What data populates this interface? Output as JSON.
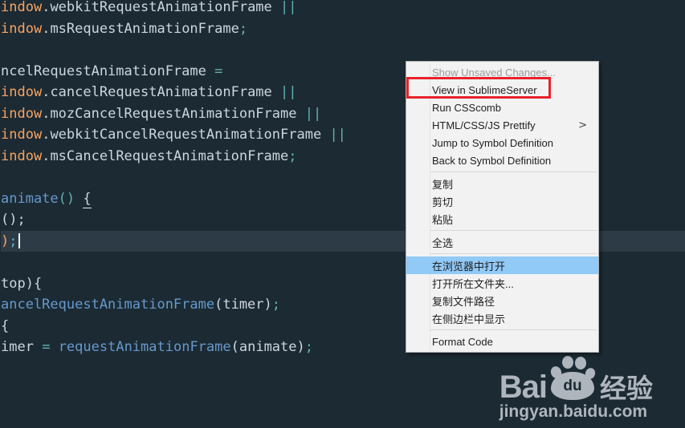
{
  "editor": {
    "background": "#1c2a33",
    "line_highlight": "#2d3b46",
    "caret_color": "#f2f6f8",
    "palette": {
      "fg": "#ccd6de",
      "orange": "#f9a35f",
      "teal": "#5fb3b3",
      "blue": "#6699cc"
    },
    "lines": [
      {
        "tokens": [
          {
            "t": "indow",
            "c": "orange"
          },
          {
            "t": ".",
            "c": "fg"
          },
          {
            "t": "webkitRequestAnimationFrame ",
            "c": "fg"
          },
          {
            "t": "||",
            "c": "teal"
          }
        ]
      },
      {
        "tokens": [
          {
            "t": "indow",
            "c": "orange"
          },
          {
            "t": ".",
            "c": "fg"
          },
          {
            "t": "msRequestAnimationFrame",
            "c": "fg"
          },
          {
            "t": ";",
            "c": "teal"
          }
        ]
      },
      {
        "tokens": []
      },
      {
        "tokens": [
          {
            "t": "ncelRequestAnimationFrame ",
            "c": "fg"
          },
          {
            "t": "=",
            "c": "teal"
          }
        ]
      },
      {
        "tokens": [
          {
            "t": "indow",
            "c": "orange"
          },
          {
            "t": ".",
            "c": "fg"
          },
          {
            "t": "cancelRequestAnimationFrame ",
            "c": "fg"
          },
          {
            "t": "||",
            "c": "teal"
          }
        ]
      },
      {
        "tokens": [
          {
            "t": "indow",
            "c": "orange"
          },
          {
            "t": ".",
            "c": "fg"
          },
          {
            "t": "mozCancelRequestAnimationFrame ",
            "c": "fg"
          },
          {
            "t": "||",
            "c": "teal"
          }
        ]
      },
      {
        "tokens": [
          {
            "t": "indow",
            "c": "orange"
          },
          {
            "t": ".",
            "c": "fg"
          },
          {
            "t": "webkitCancelRequestAnimationFrame ",
            "c": "fg"
          },
          {
            "t": "||",
            "c": "teal"
          }
        ]
      },
      {
        "tokens": [
          {
            "t": "indow",
            "c": "orange"
          },
          {
            "t": ".",
            "c": "fg"
          },
          {
            "t": "msCancelRequestAnimationFrame",
            "c": "fg"
          },
          {
            "t": ";",
            "c": "teal"
          }
        ]
      },
      {
        "tokens": []
      },
      {
        "tokens": [
          {
            "t": "animate",
            "c": "blue"
          },
          {
            "t": "()",
            "c": "teal"
          },
          {
            "t": " ",
            "c": "fg"
          },
          {
            "t": "{",
            "c": "fg",
            "u": true
          }
        ]
      },
      {
        "tokens": [
          {
            "t": "();",
            "c": "fg"
          }
        ]
      },
      {
        "tokens": [
          {
            "t": ")",
            "c": "orange"
          },
          {
            "t": ";",
            "c": "teal"
          }
        ],
        "current": true,
        "caret": true
      },
      {
        "tokens": []
      },
      {
        "tokens": [
          {
            "t": "top){",
            "c": "fg"
          }
        ]
      },
      {
        "tokens": [
          {
            "t": "ancelRequestAnimationFrame",
            "c": "blue"
          },
          {
            "t": "(timer)",
            "c": "fg"
          },
          {
            "t": ";",
            "c": "teal"
          }
        ]
      },
      {
        "tokens": [
          {
            "t": "{",
            "c": "fg"
          }
        ]
      },
      {
        "tokens": [
          {
            "t": "imer ",
            "c": "fg"
          },
          {
            "t": "=",
            "c": "teal"
          },
          {
            "t": " ",
            "c": "fg"
          },
          {
            "t": "requestAnimationFrame",
            "c": "blue"
          },
          {
            "t": "(animate)",
            "c": "fg"
          },
          {
            "t": ";",
            "c": "teal"
          }
        ]
      }
    ]
  },
  "context_menu": {
    "background": "#f2f2f2",
    "border": "#b0b0b0",
    "highlight": "#91c9f7",
    "text_color": "#1f1f1f",
    "disabled_color": "#9b9b9b",
    "submenu_arrow": ">",
    "items": [
      {
        "name": "show-unsaved-changes",
        "label": "Show Unsaved Changes...",
        "disabled": true
      },
      {
        "name": "view-in-sublimeserver",
        "label": "View in SublimeServer",
        "annotated": true
      },
      {
        "name": "run-csscomb",
        "label": "Run CSScomb"
      },
      {
        "name": "html-css-js-prettify",
        "label": "HTML/CSS/JS Prettify",
        "submenu": true
      },
      {
        "name": "jump-to-symbol-definition",
        "label": "Jump to Symbol Definition"
      },
      {
        "name": "back-to-symbol-definition",
        "label": "Back to Symbol Definition"
      },
      {
        "separator": true
      },
      {
        "name": "copy",
        "label": "复制"
      },
      {
        "name": "cut",
        "label": "剪切"
      },
      {
        "name": "paste",
        "label": "粘贴"
      },
      {
        "separator": true
      },
      {
        "name": "select-all",
        "label": "全选"
      },
      {
        "separator": true
      },
      {
        "name": "open-in-browser",
        "label": "在浏览器中打开",
        "highlighted": true
      },
      {
        "name": "open-containing-folder",
        "label": "打开所在文件夹..."
      },
      {
        "name": "copy-file-path",
        "label": "复制文件路径"
      },
      {
        "name": "reveal-in-sidebar",
        "label": "在侧边栏中显示"
      },
      {
        "separator": true
      },
      {
        "name": "format-code",
        "label": "Format Code"
      }
    ]
  },
  "annotation": {
    "box_color": "#e9222b"
  },
  "watermark": {
    "color": "#aeb5bc",
    "brand_left": "Bai",
    "paw_text": "du",
    "brand_right": "经验",
    "url": "jingyan.baidu.com"
  }
}
